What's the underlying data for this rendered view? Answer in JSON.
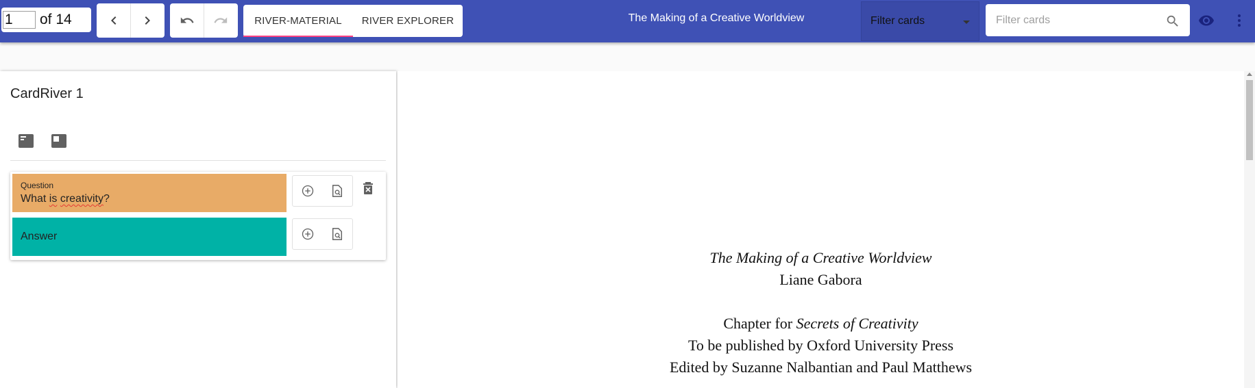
{
  "toolbar": {
    "page_value": "1",
    "page_total": "of 14",
    "tabs": [
      {
        "label": "RIVER-MATERIAL",
        "active": true
      },
      {
        "label": "RIVER EXPLORER",
        "active": false
      }
    ],
    "title": "The Making of a Creative Worldview",
    "filter_select": "Filter cards",
    "search_placeholder": "Filter cards",
    "icons": [
      "chevron-left-icon",
      "chevron-right-icon",
      "undo-icon",
      "redo-icon",
      "search-icon",
      "eye-icon",
      "more-vert-icon"
    ],
    "colors": {
      "bar": "#3f51b5",
      "tab_indicator": "#ff4081"
    }
  },
  "river": {
    "title": "CardRiver 1",
    "view_icons": [
      "card-view-icon",
      "split-view-icon"
    ],
    "card": {
      "question_label": "Question",
      "question_text_pre": "What ",
      "question_text_misspelled_1": "is",
      "question_text_mid": " ",
      "question_text_misspelled_2": "creativity",
      "question_text_post": "?",
      "answer_label": "Answer",
      "colors": {
        "question": "#e8ab67",
        "answer": "#00b2a6"
      },
      "action_icons": [
        "add-circle-icon",
        "note-search-icon",
        "delete-icon"
      ]
    }
  },
  "document": {
    "title_italic": "The Making of a Creative Worldview",
    "author": "Liane Gabora",
    "chapter_prefix": "Chapter for ",
    "chapter_italic": "Secrets of Creativity",
    "publisher": "To be published by Oxford University Press",
    "editors": "Edited by Suzanne Nalbantian and Paul Matthews"
  }
}
